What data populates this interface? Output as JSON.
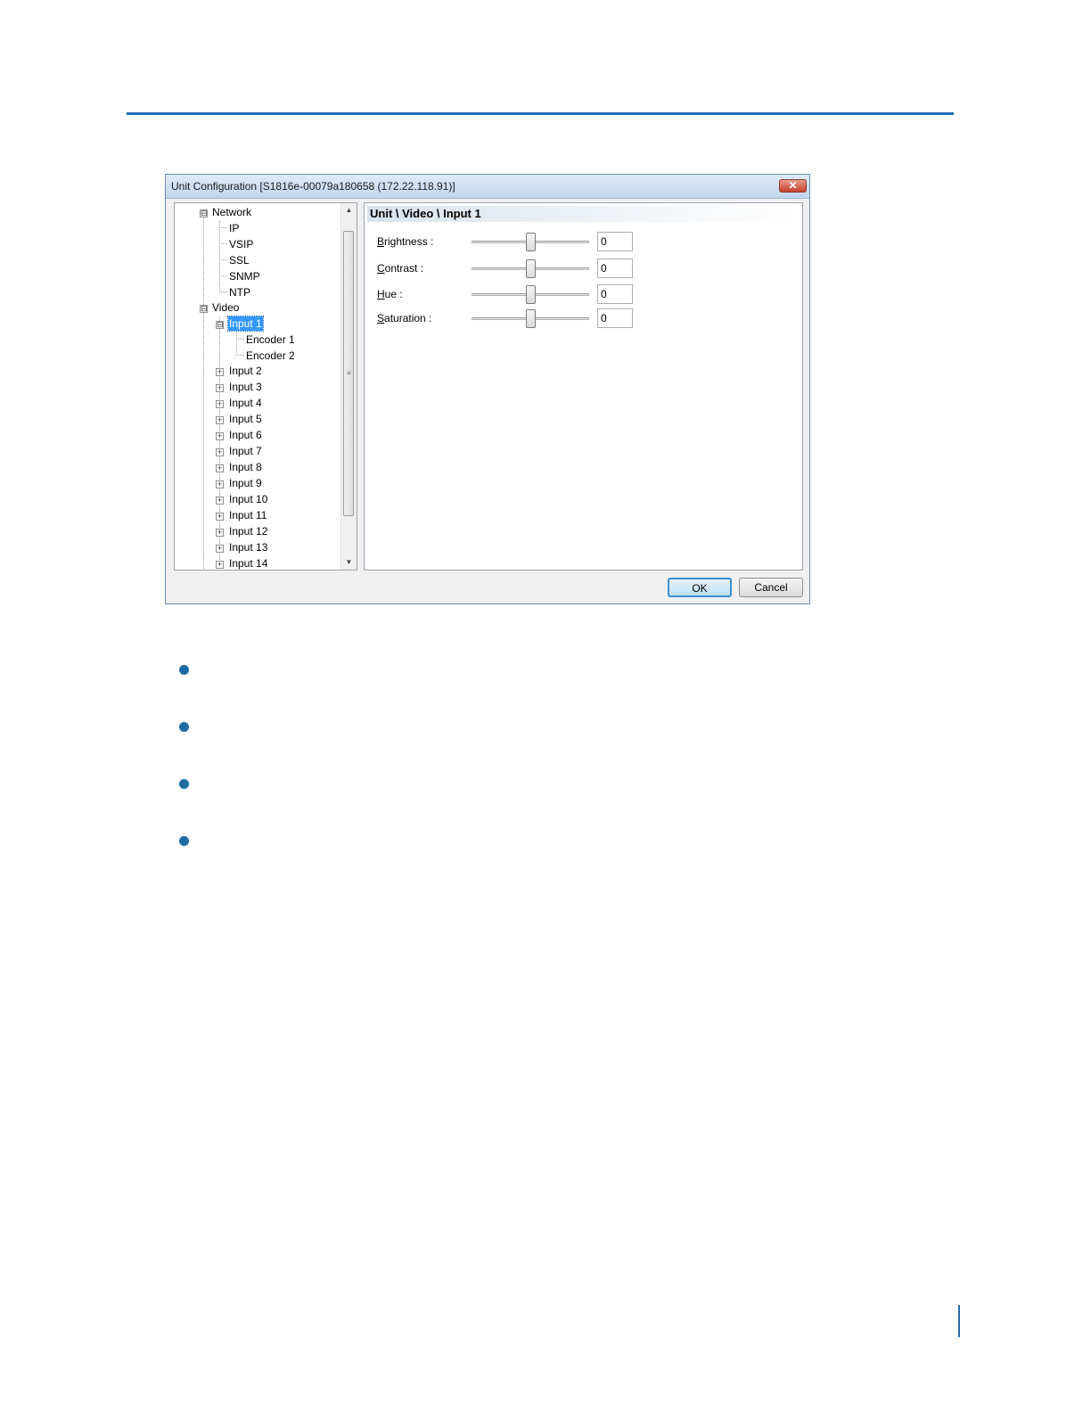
{
  "dialog": {
    "title": "Unit Configuration [S1816e-00079a180658 (172.22.118.91)]",
    "close_label": "✕"
  },
  "tree": {
    "network": {
      "label": "Network",
      "expander": "⊟",
      "children": [
        "IP",
        "VSIP",
        "SSL",
        "SNMP",
        "NTP"
      ]
    },
    "video": {
      "label": "Video",
      "expander": "⊟",
      "input1": {
        "label": "Input 1",
        "selected": true,
        "children": [
          "Encoder 1",
          "Encoder 2"
        ]
      },
      "inputs": [
        "Input 2",
        "Input 3",
        "Input 4",
        "Input 5",
        "Input 6",
        "Input 7",
        "Input 8",
        "Input 9",
        "Input 10",
        "Input 11",
        "Input 12",
        "Input 13",
        "Input 14"
      ]
    }
  },
  "content": {
    "header": "Unit \\ Video \\ Input 1",
    "sliders": [
      {
        "accel": "B",
        "rest": "rightness :",
        "value": "0"
      },
      {
        "accel": "C",
        "rest": "ontrast :",
        "value": "0"
      },
      {
        "accel": "H",
        "rest": "ue :",
        "value": "0"
      },
      {
        "accel": "S",
        "rest": "aturation :",
        "value": "0"
      }
    ]
  },
  "buttons": {
    "ok": "OK",
    "cancel": "Cancel"
  },
  "colors": {
    "accent": "#1f6fb5",
    "bullet": "#1c6aa3",
    "selection": "#3399ff"
  }
}
